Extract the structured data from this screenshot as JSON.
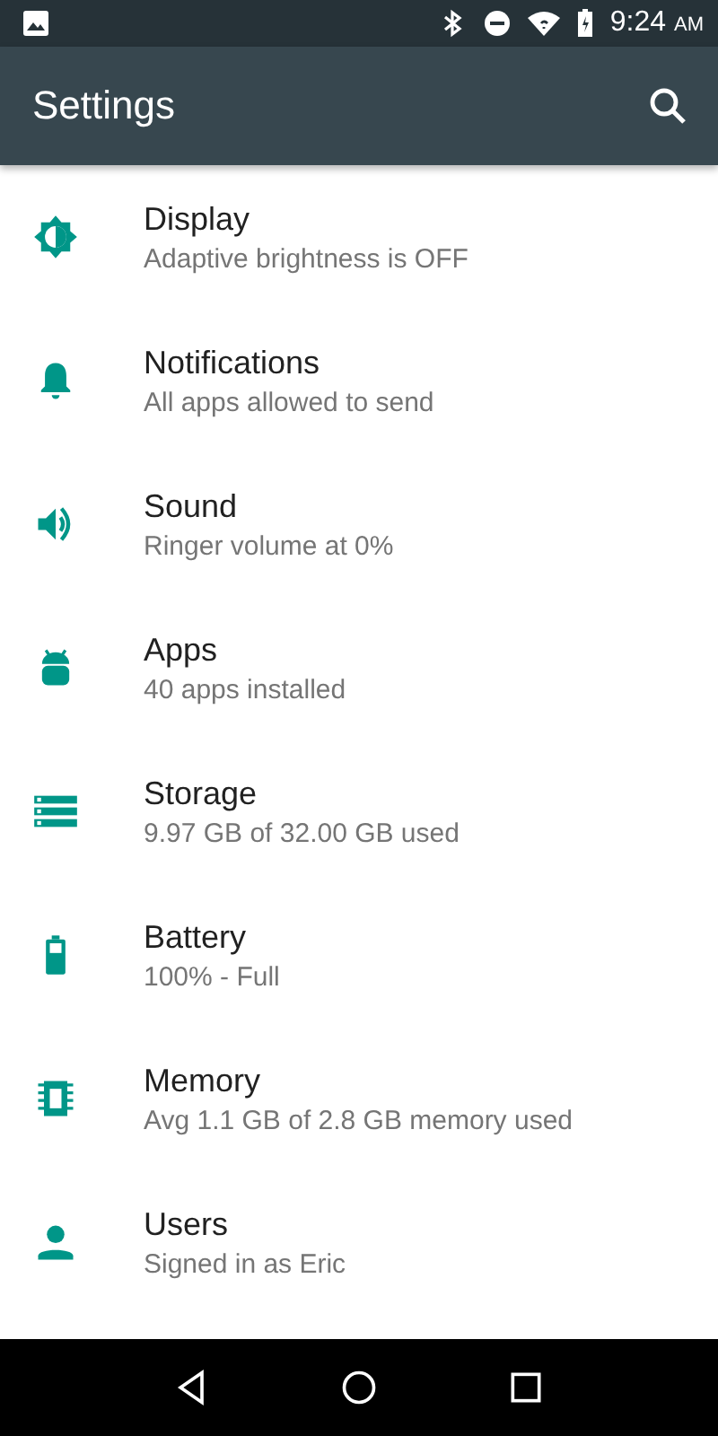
{
  "status_bar": {
    "time": "9:24",
    "meridiem": "AM"
  },
  "toolbar": {
    "title": "Settings"
  },
  "items": [
    {
      "kind": "display",
      "title": "Display",
      "subtitle": "Adaptive brightness is OFF"
    },
    {
      "kind": "notifications",
      "title": "Notifications",
      "subtitle": "All apps allowed to send"
    },
    {
      "kind": "sound",
      "title": "Sound",
      "subtitle": "Ringer volume at 0%"
    },
    {
      "kind": "apps",
      "title": "Apps",
      "subtitle": "40 apps installed"
    },
    {
      "kind": "storage",
      "title": "Storage",
      "subtitle": "9.97 GB of 32.00 GB used"
    },
    {
      "kind": "battery",
      "title": "Battery",
      "subtitle": "100% - Full"
    },
    {
      "kind": "memory",
      "title": "Memory",
      "subtitle": "Avg 1.1 GB of 2.8 GB memory used"
    },
    {
      "kind": "users",
      "title": "Users",
      "subtitle": "Signed in as Eric"
    }
  ]
}
